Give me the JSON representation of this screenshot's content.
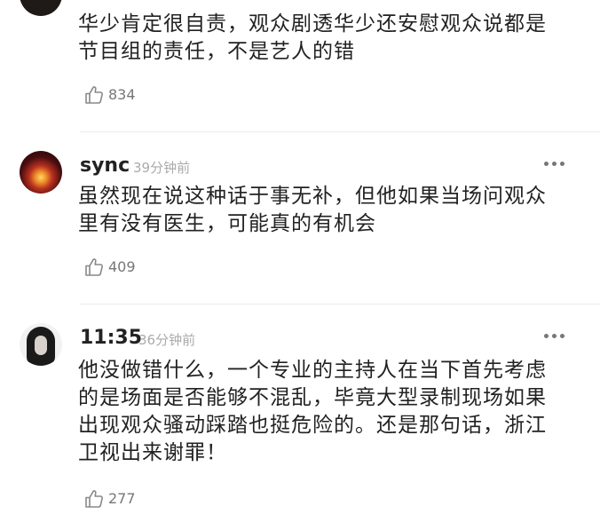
{
  "comments": [
    {
      "username": "",
      "time": "",
      "lines": [
        "华少肯定很自责，观众剧透华少还安慰观众说都是",
        "节目组的责任，不是艺人的错"
      ],
      "likes": "834"
    },
    {
      "username": "sync",
      "time": "39分钟前",
      "lines": [
        "虽然现在说这种话于事无补，但他如果当场问观众",
        "里有没有医生，可能真的有机会"
      ],
      "likes": "409"
    },
    {
      "username": "11:35",
      "time": "36分钟前",
      "lines": [
        "他没做错什么，一个专业的主持人在当下首先考虑",
        "的是场面是否能够不混乱，毕竟大型录制现场如果",
        "出现观众骚动踩踏也挺危险的。还是那句话，浙江",
        "卫视出来谢罪！"
      ],
      "likes": "277"
    }
  ],
  "icons": {
    "like": "thumbs-up-icon",
    "more": "more-dots-icon"
  }
}
